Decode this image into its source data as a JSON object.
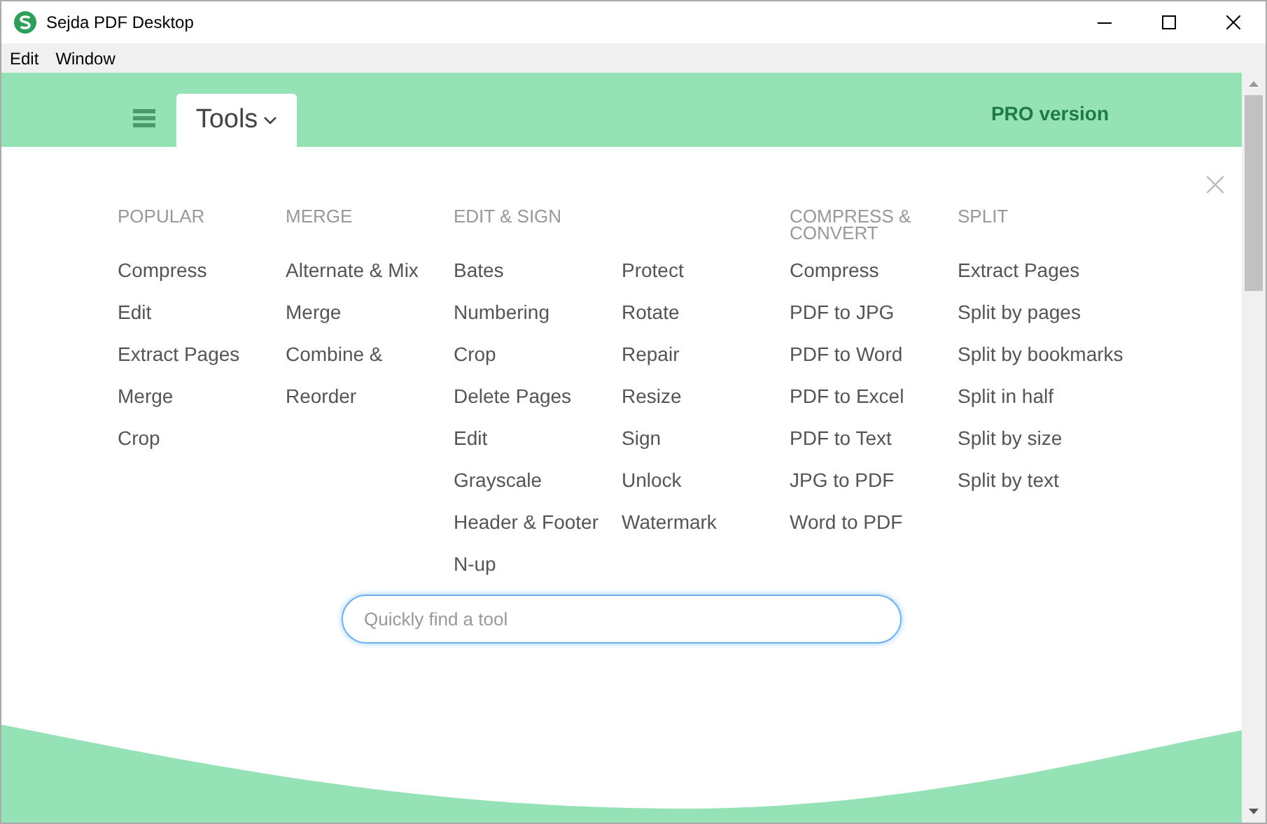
{
  "window": {
    "title": "Sejda PDF Desktop"
  },
  "menu": [
    "Edit",
    "Window"
  ],
  "header": {
    "tab": "Tools",
    "pro_link": "PRO version"
  },
  "groups": [
    {
      "heading": "POPULAR",
      "columns": [
        [
          "Compress",
          "Edit",
          "Extract Pages",
          "Merge",
          "Crop"
        ]
      ]
    },
    {
      "heading": "MERGE",
      "columns": [
        [
          "Alternate & Mix",
          "Merge",
          "Combine &",
          "Reorder"
        ]
      ]
    },
    {
      "heading": "EDIT & SIGN",
      "columns": [
        [
          "Bates",
          "Numbering",
          "Crop",
          "Delete Pages",
          "Edit",
          "Grayscale",
          "Header & Footer",
          "N-up"
        ],
        [
          "Protect",
          "Rotate",
          "Repair",
          "Resize",
          "Sign",
          "Unlock",
          "Watermark"
        ]
      ]
    },
    {
      "heading": "COMPRESS & CONVERT",
      "columns": [
        [
          "Compress",
          "PDF to JPG",
          "PDF to Word",
          "PDF to Excel",
          "PDF to Text",
          "JPG to PDF",
          "Word to PDF"
        ]
      ]
    },
    {
      "heading": "SPLIT",
      "columns": [
        [
          "Extract Pages",
          "Split by pages",
          "Split by bookmarks",
          "Split in half",
          "Split by size",
          "Split by text"
        ]
      ]
    }
  ],
  "search": {
    "placeholder": "Quickly find a tool"
  }
}
